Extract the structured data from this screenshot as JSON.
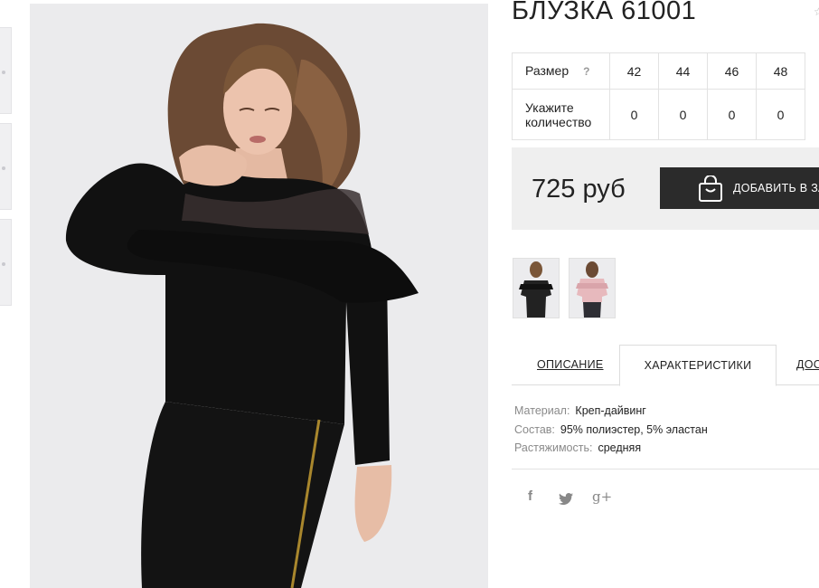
{
  "product": {
    "title": "БЛУЗКА 61001",
    "price": "725 руб"
  },
  "size_table": {
    "size_label": "Размер",
    "help_mark": "?",
    "quantity_label_line1": "Укажите",
    "quantity_label_line2": "количество",
    "sizes": [
      "42",
      "44",
      "46",
      "48"
    ],
    "quantities": [
      "0",
      "0",
      "0",
      "0"
    ]
  },
  "cart": {
    "button_label": "ДОБАВИТЬ В ЗАКАЗ",
    "icon": "shopping-bag-icon"
  },
  "tabs": {
    "description": "ОПИСАНИЕ",
    "characteristics": "ХАРАКТЕРИСТИКИ",
    "delivery": "ДОСТАВКА",
    "active": "characteristics"
  },
  "specs": [
    {
      "key": "Материал:",
      "value": "Креп-дайвинг"
    },
    {
      "key": "Состав:",
      "value": "95% полиэстер, 5% эластан"
    },
    {
      "key": "Растяжимость:",
      "value": "средняя"
    }
  ],
  "social": {
    "facebook": "f",
    "twitter": "twitter-bird-icon",
    "googleplus": "g+"
  },
  "colors": {
    "accent_dark": "#2b2b2b",
    "panel_bg": "#efefef",
    "photo_bg": "#ebebed",
    "garment": "#111111",
    "variant_pink": "#e7b9bd"
  }
}
